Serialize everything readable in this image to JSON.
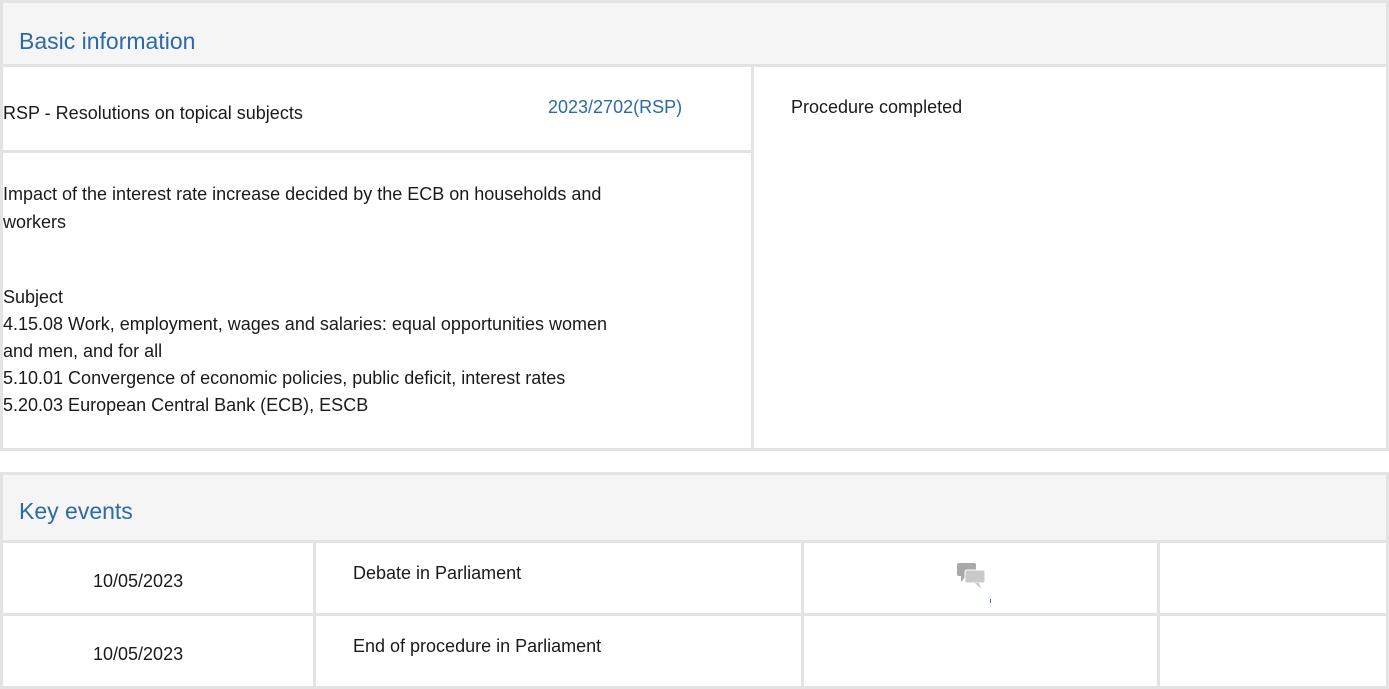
{
  "basic_information": {
    "heading": "Basic information",
    "procedure_type": "RSP - Resolutions on topical subjects",
    "reference": "2023/2702(RSP)",
    "status": "Procedure completed",
    "title_line1": "Impact of the interest rate increase decided by the ECB on households and",
    "title_line2": "workers",
    "subject_label": "Subject",
    "subjects": [
      "4.15.08 Work, employment, wages and salaries: equal opportunities women",
      "and men, and for all",
      "5.10.01 Convergence of economic policies, public deficit, interest rates",
      "5.20.03 European Central Bank (ECB), ESCB"
    ]
  },
  "key_events": {
    "heading": "Key events",
    "rows": [
      {
        "date": "10/05/2023",
        "event": "Debate in Parliament",
        "icon": "debate-icon"
      },
      {
        "date": "10/05/2023",
        "event": "End of procedure in Parliament",
        "icon": ""
      }
    ]
  },
  "colors": {
    "accent": "#2b6aa6",
    "border": "#e3e3e3",
    "header_bg": "#f5f5f5"
  }
}
